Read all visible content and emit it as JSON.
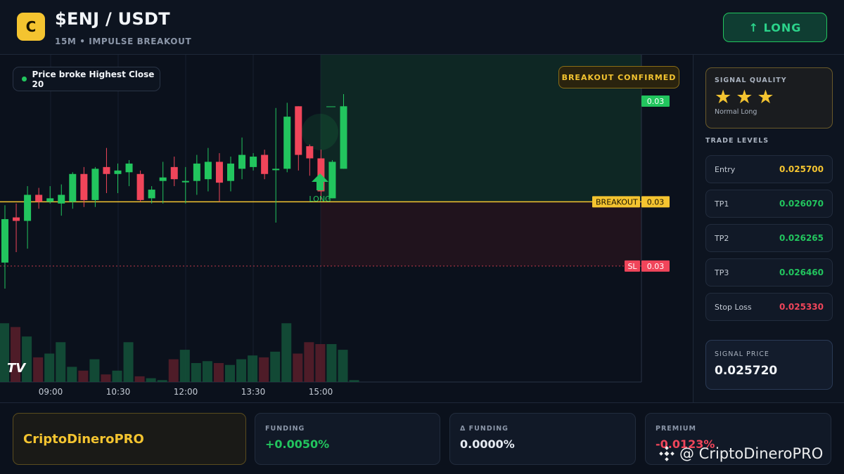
{
  "header": {
    "logo_letter": "C",
    "pair": "$ENJ / USDT",
    "subtitle": "15M • IMPULSE BREAKOUT",
    "long_button": "↑ LONG"
  },
  "chart": {
    "info_pill": "Price broke Highest Close 20",
    "confirm_badge": "BREAKOUT CONFIRMED",
    "signal_marker_label": "LONG",
    "breakout_tag": "BREAKOUT",
    "breakout_value": "0.03",
    "top_tag_value": "0.03",
    "sl_tag": "SL",
    "sl_value": "0.03",
    "tv_logo": "TV",
    "time_labels": [
      "09:00",
      "10:30",
      "12:00",
      "13:30",
      "15:00"
    ],
    "colors": {
      "up": "#22c55e",
      "down": "#f0455a",
      "breakout_line": "#f4c430",
      "sl_line": "#f0455a"
    },
    "candles": [
      {
        "o": 0.02535,
        "h": 0.02568,
        "l": 0.0252,
        "c": 0.0256
      },
      {
        "o": 0.02561,
        "h": 0.02569,
        "l": 0.02541,
        "c": 0.02559
      },
      {
        "o": 0.02559,
        "h": 0.02579,
        "l": 0.02543,
        "c": 0.02574
      },
      {
        "o": 0.02574,
        "h": 0.02578,
        "l": 0.02566,
        "c": 0.0257
      },
      {
        "o": 0.0257,
        "h": 0.02579,
        "l": 0.02569,
        "c": 0.02572
      },
      {
        "o": 0.02569,
        "h": 0.0258,
        "l": 0.02562,
        "c": 0.02574
      },
      {
        "o": 0.0257,
        "h": 0.02587,
        "l": 0.02566,
        "c": 0.02586
      },
      {
        "o": 0.02586,
        "h": 0.0259,
        "l": 0.02567,
        "c": 0.02571
      },
      {
        "o": 0.02571,
        "h": 0.0259,
        "l": 0.02567,
        "c": 0.02589
      },
      {
        "o": 0.0259,
        "h": 0.02601,
        "l": 0.02575,
        "c": 0.02586
      },
      {
        "o": 0.02586,
        "h": 0.02592,
        "l": 0.02575,
        "c": 0.02588
      },
      {
        "o": 0.02587,
        "h": 0.02594,
        "l": 0.02579,
        "c": 0.02592
      },
      {
        "o": 0.02586,
        "h": 0.02588,
        "l": 0.0257,
        "c": 0.02571
      },
      {
        "o": 0.02572,
        "h": 0.02579,
        "l": 0.02569,
        "c": 0.02577
      },
      {
        "o": 0.02582,
        "h": 0.02593,
        "l": 0.02569,
        "c": 0.02584
      },
      {
        "o": 0.0259,
        "h": 0.02596,
        "l": 0.02579,
        "c": 0.02583
      },
      {
        "o": 0.02582,
        "h": 0.0259,
        "l": 0.02569,
        "c": 0.02582
      },
      {
        "o": 0.02582,
        "h": 0.02597,
        "l": 0.02574,
        "c": 0.02592
      },
      {
        "o": 0.02583,
        "h": 0.02601,
        "l": 0.02576,
        "c": 0.02593
      },
      {
        "o": 0.02593,
        "h": 0.02598,
        "l": 0.0257,
        "c": 0.02581
      },
      {
        "o": 0.02582,
        "h": 0.02596,
        "l": 0.02576,
        "c": 0.02592
      },
      {
        "o": 0.02589,
        "h": 0.02607,
        "l": 0.02583,
        "c": 0.02597
      },
      {
        "o": 0.0259,
        "h": 0.02598,
        "l": 0.02588,
        "c": 0.02596
      },
      {
        "o": 0.02597,
        "h": 0.026,
        "l": 0.02583,
        "c": 0.02586
      },
      {
        "o": 0.02589,
        "h": 0.02624,
        "l": 0.02558,
        "c": 0.02589
      },
      {
        "o": 0.02589,
        "h": 0.02627,
        "l": 0.02587,
        "c": 0.02619
      },
      {
        "o": 0.02625,
        "h": 0.02625,
        "l": 0.02588,
        "c": 0.02597
      },
      {
        "o": 0.02602,
        "h": 0.02603,
        "l": 0.02585,
        "c": 0.02595
      },
      {
        "o": 0.02595,
        "h": 0.026,
        "l": 0.02571,
        "c": 0.02576
      },
      {
        "o": 0.02572,
        "h": 0.02594,
        "l": 0.02572,
        "c": 0.02593
      },
      {
        "o": 0.02589,
        "h": 0.02632,
        "l": 0.02589,
        "c": 0.02625
      }
    ],
    "volumes": [
      62,
      58,
      48,
      26,
      30,
      42,
      16,
      12,
      24,
      8,
      12,
      42,
      6,
      4,
      2,
      24,
      34,
      20,
      22,
      20,
      18,
      24,
      28,
      26,
      32,
      62,
      30,
      42,
      40,
      40,
      34,
      2
    ],
    "price_breakout": 0.0257,
    "price_sl": 0.02533
  },
  "sidebar": {
    "quality_title": "SIGNAL QUALITY",
    "stars": "★★★",
    "quality_sub": "Normal Long",
    "levels_title": "TRADE LEVELS",
    "levels": [
      {
        "label": "Entry",
        "value": "0.025700",
        "color": "#f4c430"
      },
      {
        "label": "TP1",
        "value": "0.026070",
        "color": "#22c55e"
      },
      {
        "label": "TP2",
        "value": "0.026265",
        "color": "#22c55e"
      },
      {
        "label": "TP3",
        "value": "0.026460",
        "color": "#22c55e"
      },
      {
        "label": "Stop Loss",
        "value": "0.025330",
        "color": "#f0455a"
      }
    ],
    "signal_label": "SIGNAL PRICE",
    "signal_value": "0.025720"
  },
  "footer": {
    "brand": "CriptoDineroPRO",
    "stats": [
      {
        "label": "FUNDING",
        "value": "+0.0050%",
        "color": "#22c55e"
      },
      {
        "label": "Δ FUNDING",
        "value": "0.0000%",
        "color": "#e6ebf2"
      },
      {
        "label": "PREMIUM",
        "value": "-0.0123%",
        "color": "#f0455a"
      }
    ],
    "watermark": "@ CriptoDineroPRO"
  }
}
